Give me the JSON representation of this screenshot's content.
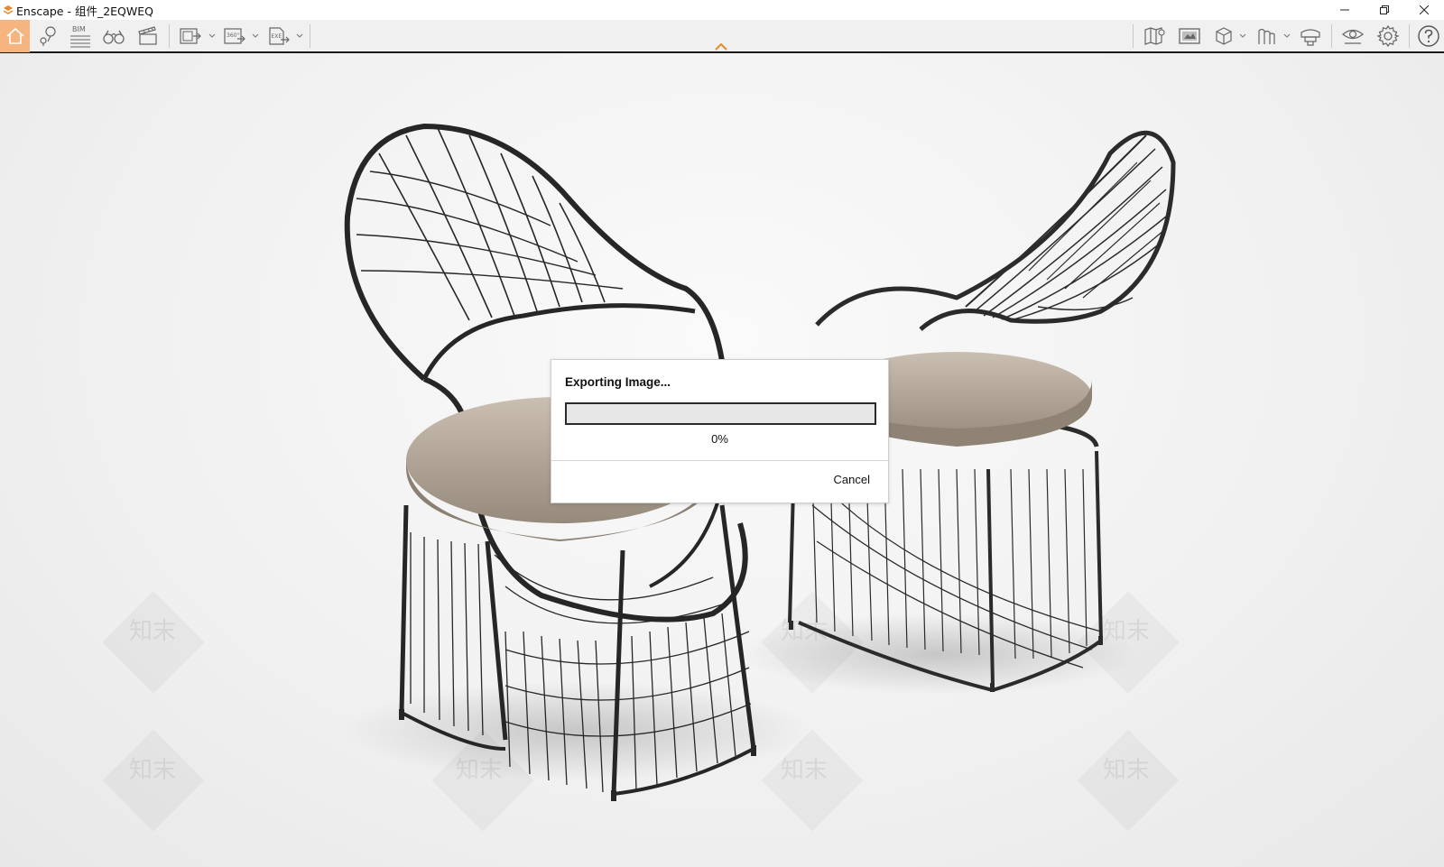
{
  "window": {
    "title": "Enscape - 组件_2EQWEQ"
  },
  "toolbar": {
    "bim_label": "BIM",
    "360_label": "360°",
    "exe_label": "EXE",
    "accent_color": "#f6b47f"
  },
  "icons": {
    "left": [
      "home-icon",
      "location-pin-icon",
      "bim-icon",
      "binoculars-icon",
      "clapperboard-icon",
      "export-image-icon",
      "export-panorama-icon",
      "export-exe-icon"
    ],
    "right": [
      "map-icon",
      "screen-icon",
      "cube-icon",
      "asset-library-icon",
      "cap-icon",
      "eye-icon",
      "gear-icon",
      "help-icon"
    ]
  },
  "watermark": {
    "text": "知末"
  },
  "dialog": {
    "title": "Exporting Image...",
    "progress": 0,
    "progress_text": "0%",
    "cancel_label": "Cancel"
  }
}
